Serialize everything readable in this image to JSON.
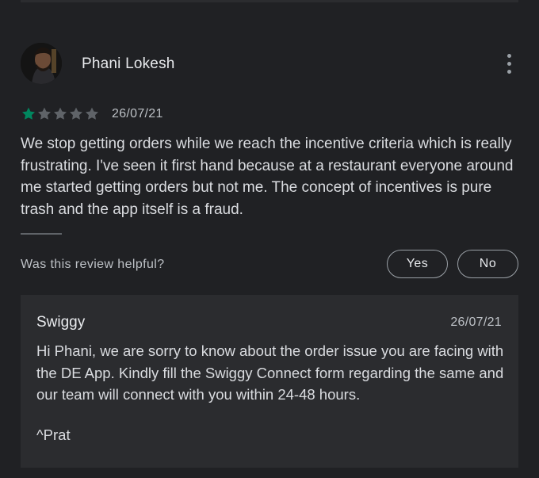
{
  "review": {
    "reviewer_name": "Phani Lokesh",
    "rating": 1,
    "max_rating": 5,
    "date": "26/07/21",
    "text": "We stop getting orders while we reach the incentive criteria which is really frustrating. I've seen it first hand because at a restaurant everyone around me started getting orders but not me. The concept of incentives is pure trash and the app itself is a fraud."
  },
  "helpful": {
    "question": "Was this review helpful?",
    "yes_label": "Yes",
    "no_label": "No"
  },
  "reply": {
    "author": "Swiggy",
    "date": "26/07/21",
    "text": "Hi Phani, we are sorry to know about the order issue you are facing with the DE App. Kindly fill the Swiggy Connect form regarding the same and our team will connect with you within 24-48 hours.",
    "signoff": "^Prat"
  },
  "icons": {
    "more": "more-vert-icon",
    "star": "star-icon"
  },
  "colors": {
    "background": "#202124",
    "reply_background": "#2b2c2f",
    "star_filled": "#01875f",
    "star_empty": "#5f6368",
    "text_primary": "#e8eaed",
    "text_secondary": "#bdc1c6",
    "button_border": "#9aa0a6"
  }
}
